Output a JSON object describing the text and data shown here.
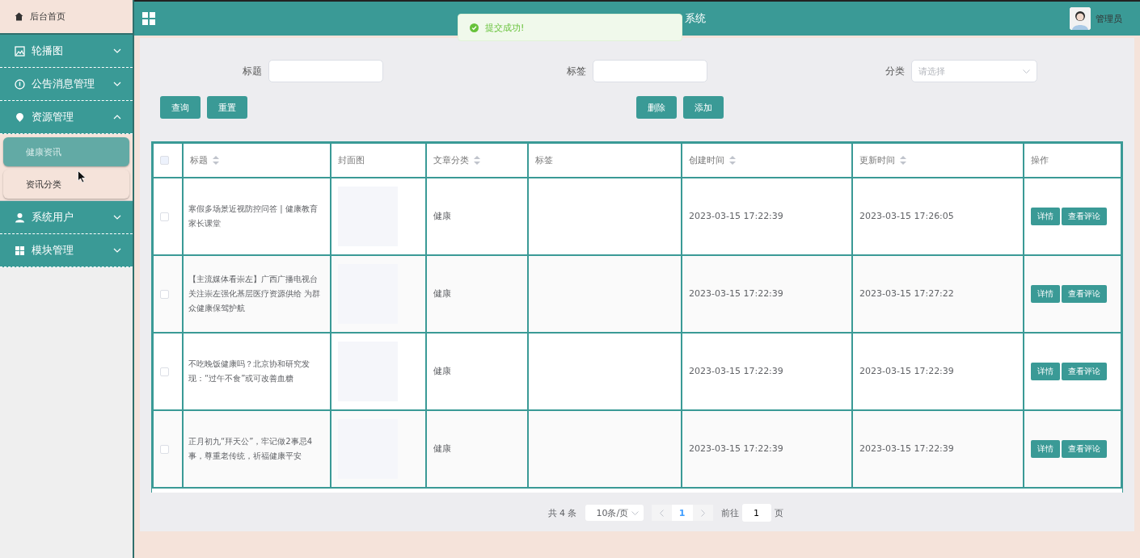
{
  "sidebar": {
    "home": "后台首页",
    "items": [
      {
        "label": "轮播图",
        "expanded": false
      },
      {
        "label": "公告消息管理",
        "expanded": false
      },
      {
        "label": "资源管理",
        "expanded": true,
        "children": [
          {
            "label": "健康资讯",
            "selected": true
          },
          {
            "label": "资讯分类",
            "selected": false
          }
        ]
      },
      {
        "label": "系统用户",
        "expanded": false
      },
      {
        "label": "模块管理",
        "expanded": false
      }
    ]
  },
  "header": {
    "title": "系统",
    "user": "管理员"
  },
  "toast": {
    "message": "提交成功!"
  },
  "filters": [
    {
      "label": "标题",
      "kind": "text"
    },
    {
      "label": "标签",
      "kind": "text"
    },
    {
      "label": "分类",
      "kind": "select",
      "placeholder": "请选择"
    }
  ],
  "left_buttons": [
    "查询",
    "重置"
  ],
  "right_buttons": [
    "删除",
    "添加"
  ],
  "table": {
    "all_checked": false,
    "columns": [
      {
        "label": "标题",
        "sortable": true
      },
      {
        "label": "封面图",
        "sortable": false
      },
      {
        "label": "文章分类",
        "sortable": true
      },
      {
        "label": "标签",
        "sortable": false
      },
      {
        "label": "创建时间",
        "sortable": true
      },
      {
        "label": "更新时间",
        "sortable": true
      },
      {
        "label": "操作",
        "sortable": false
      }
    ],
    "rows": [
      {
        "checked": false,
        "title": "寒假多场景近视防控问答 | 健康教育家长课堂",
        "category": "健康",
        "created": "2023-03-15 17:22:39",
        "updated": "2023-03-15 17:26:05",
        "actions": [
          "详情",
          "查看评论"
        ]
      },
      {
        "checked": false,
        "title": "【主流媒体看崇左】广西广播电视台关注崇左强化基层医疗资源供给 为群众健康保驾护航",
        "category": "健康",
        "created": "2023-03-15 17:22:39",
        "updated": "2023-03-15 17:27:22",
        "actions": [
          "详情",
          "查看评论"
        ]
      },
      {
        "checked": false,
        "title": "不吃晚饭健康吗？北京协和研究发现：“过午不食”或可改善血糖",
        "category": "健康",
        "created": "2023-03-15 17:22:39",
        "updated": "2023-03-15 17:22:39",
        "actions": [
          "详情",
          "查看评论"
        ]
      },
      {
        "checked": false,
        "title": "正月初九“拜天公”，牢记做2事忌4事，尊重老传统，祈福健康平安",
        "category": "健康",
        "created": "2023-03-15 17:22:39",
        "updated": "2023-03-15 17:22:39",
        "actions": [
          "详情",
          "查看评论"
        ]
      }
    ]
  },
  "pagination": {
    "total": "共 4 条",
    "page_size": "10条/页",
    "pages": [
      {
        "label": "1",
        "selected": true
      }
    ],
    "goto_label": "前往",
    "goto_value": "1",
    "goto_suffix": "页"
  }
}
